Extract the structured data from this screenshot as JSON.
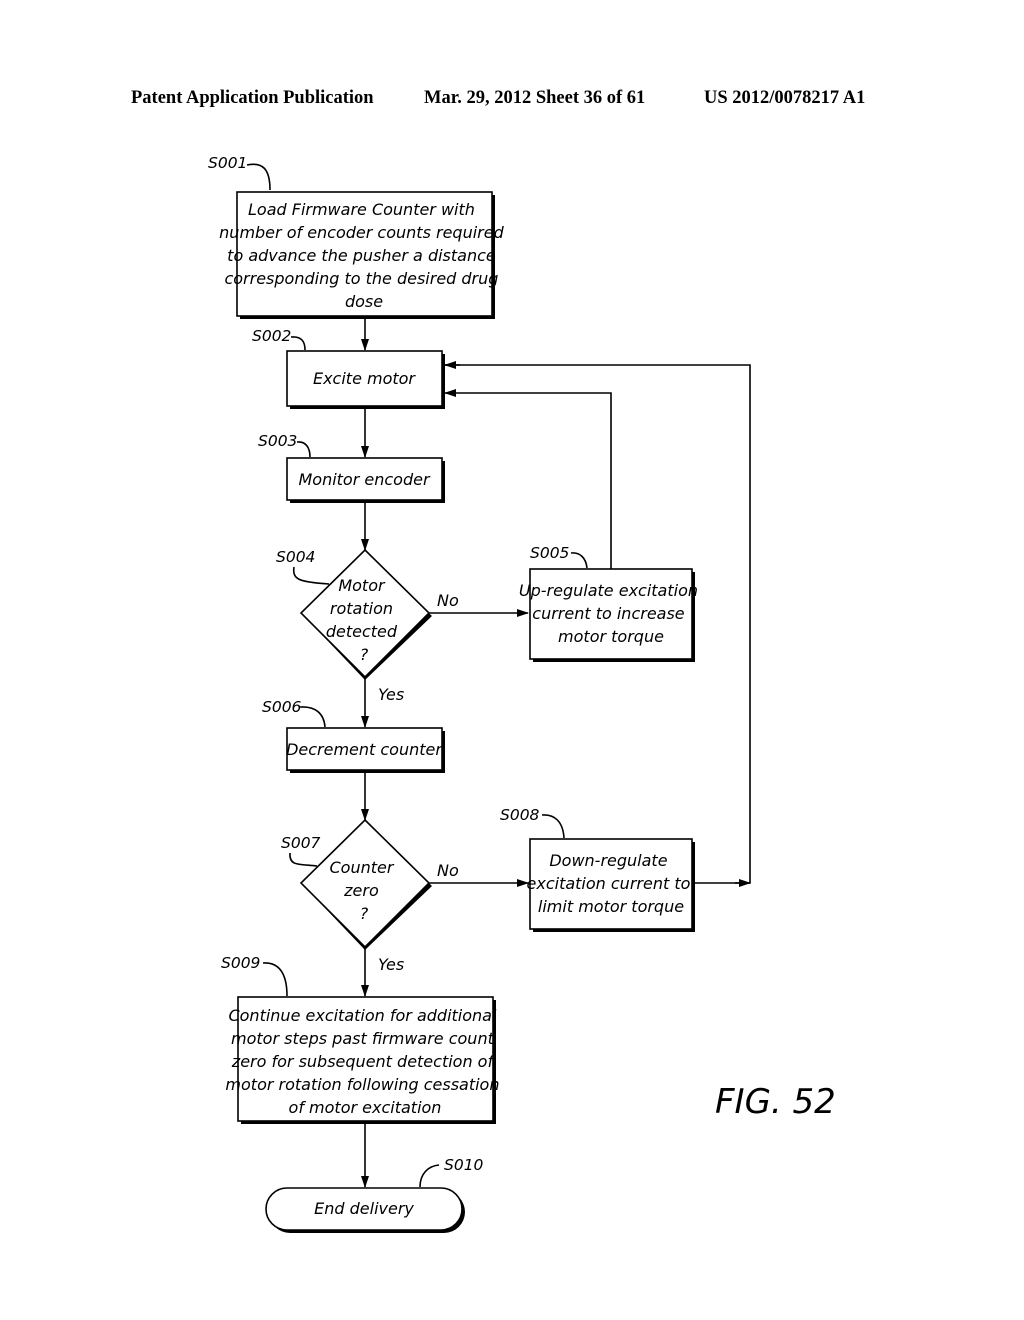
{
  "header": {
    "publication": "Patent Application Publication",
    "date_sheet": "Mar. 29, 2012  Sheet 36 of 61",
    "number": "US 2012/0078217 A1"
  },
  "figure": {
    "label": "FIG. 52"
  },
  "nodes": {
    "s001": {
      "id": "S001",
      "type": "process",
      "lines": [
        "Load Firmware Counter with",
        "number of encoder counts required",
        "to advance the pusher a distance",
        "corresponding to the desired drug",
        "dose"
      ]
    },
    "s002": {
      "id": "S002",
      "type": "process",
      "lines": [
        "Excite motor"
      ]
    },
    "s003": {
      "id": "S003",
      "type": "process",
      "lines": [
        "Monitor encoder"
      ]
    },
    "s004": {
      "id": "S004",
      "type": "decision",
      "lines": [
        "Motor",
        "rotation",
        "detected",
        "?"
      ]
    },
    "s005": {
      "id": "S005",
      "type": "process",
      "lines": [
        "Up-regulate excitation",
        "current to increase",
        "motor torque"
      ]
    },
    "s006": {
      "id": "S006",
      "type": "process",
      "lines": [
        "Decrement counter"
      ]
    },
    "s007": {
      "id": "S007",
      "type": "decision",
      "lines": [
        "Counter",
        "zero",
        "?"
      ]
    },
    "s008": {
      "id": "S008",
      "type": "process",
      "lines": [
        "Down-regulate",
        "excitation current to",
        "limit motor torque"
      ]
    },
    "s009": {
      "id": "S009",
      "type": "process",
      "lines": [
        "Continue excitation for additional",
        "motor steps past firmware count",
        "zero for subsequent detection of",
        "motor rotation following cessation",
        "of motor excitation"
      ]
    },
    "s010": {
      "id": "S010",
      "type": "terminal",
      "lines": [
        "End delivery"
      ]
    }
  },
  "edges": {
    "s004_no": "No",
    "s004_yes": "Yes",
    "s007_no": "No",
    "s007_yes": "Yes"
  }
}
